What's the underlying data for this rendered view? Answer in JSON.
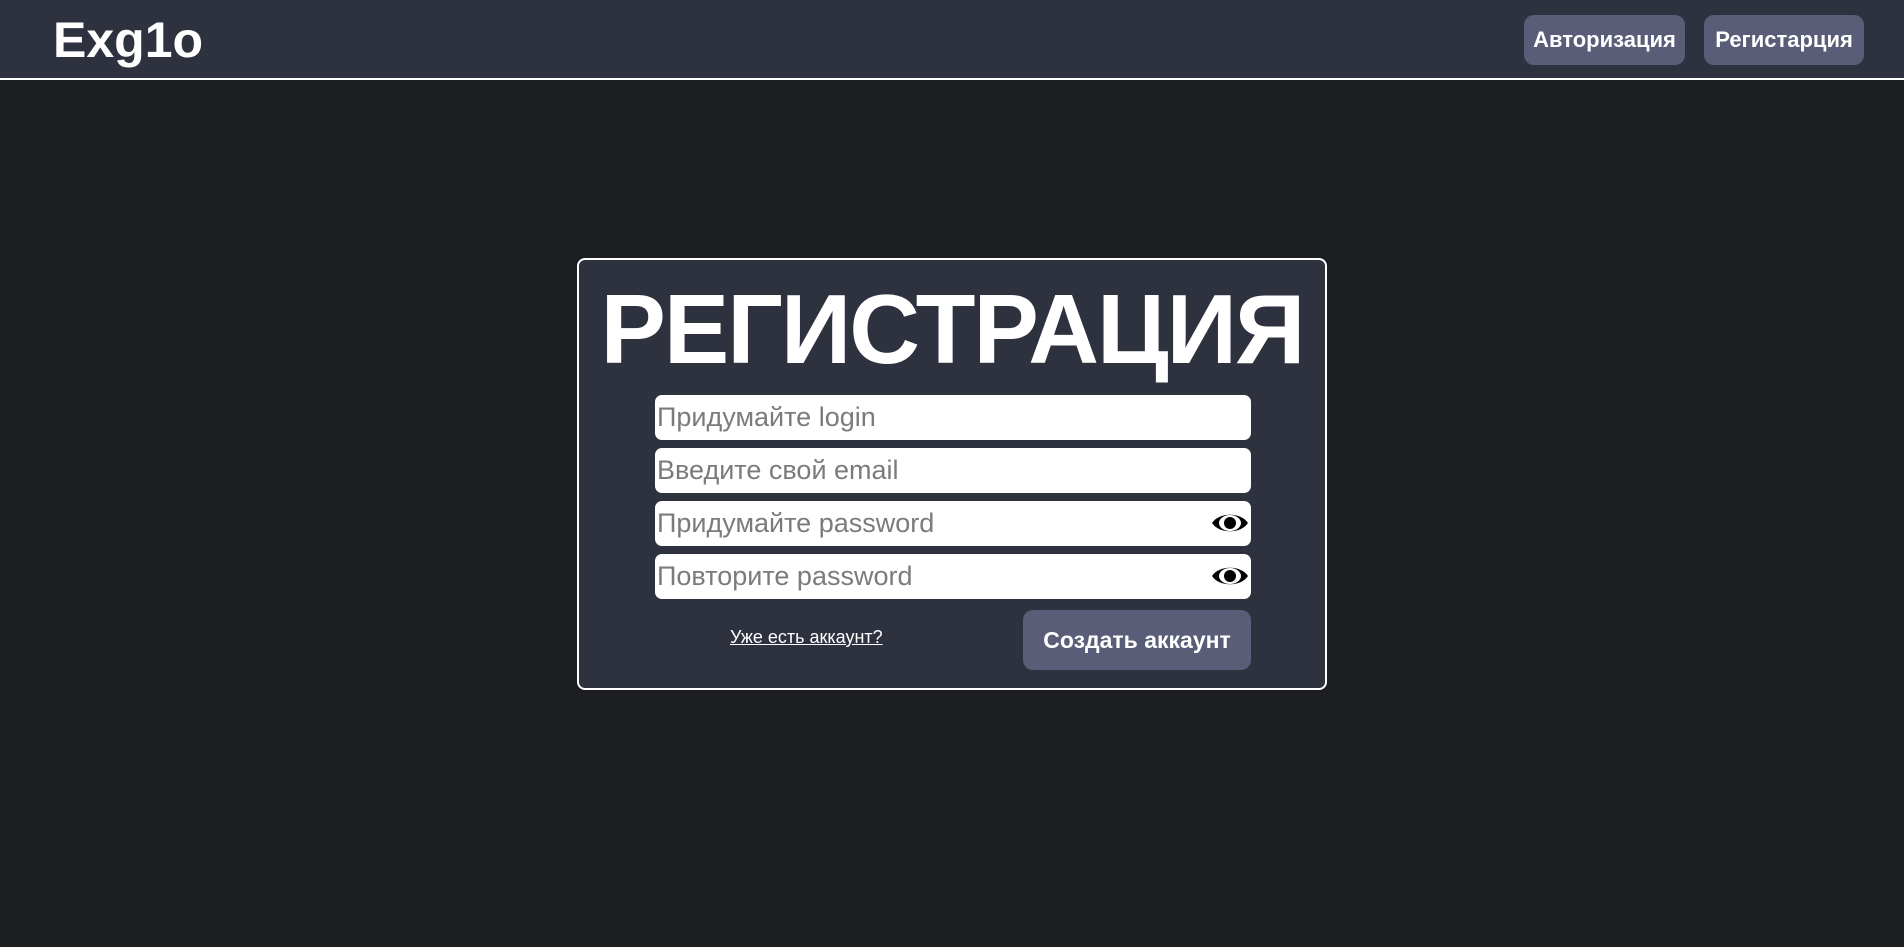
{
  "header": {
    "logo": "Exg1o",
    "nav": {
      "login_label": "Авторизация",
      "register_label": "Регистарция"
    }
  },
  "form": {
    "title": "РЕГИСТРАЦИЯ",
    "fields": {
      "login": {
        "value": "",
        "placeholder": "Придумайте login"
      },
      "email": {
        "value": "",
        "placeholder": "Введите свой email"
      },
      "password": {
        "value": "",
        "placeholder": "Придумайте password",
        "icon": "eye-icon"
      },
      "password_repeat": {
        "value": "",
        "placeholder": "Повторите password",
        "icon": "eye-icon"
      }
    },
    "have_account_link": "Уже есть аккаунт?",
    "submit_label": "Создать аккаунт"
  },
  "colors": {
    "page_background": "#1d1e22",
    "header_background": "#2e313e",
    "card_background": "#2e313e",
    "button_background": "#5a5d78",
    "text": "#ffffff"
  }
}
